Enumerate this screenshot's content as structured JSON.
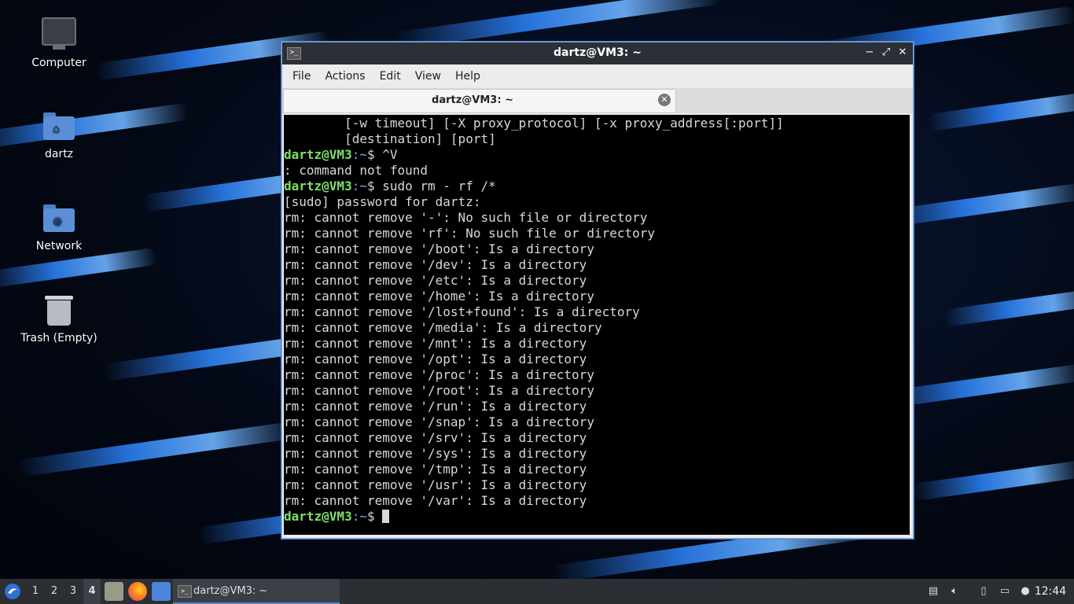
{
  "desktop": {
    "icons": [
      {
        "label": "Computer"
      },
      {
        "label": "dartz"
      },
      {
        "label": "Network"
      },
      {
        "label": "Trash (Empty)"
      }
    ]
  },
  "window": {
    "title": "dartz@VM3: ~",
    "controls": {
      "minimize": "−",
      "maximize": "⤢",
      "close": "✕"
    },
    "menu": [
      "File",
      "Actions",
      "Edit",
      "View",
      "Help"
    ],
    "tab": {
      "label": "dartz@VM3: ~",
      "close": "✕"
    }
  },
  "terminal": {
    "prompt_user": "dartz@VM3",
    "prompt_path": ":~",
    "prompt_symbol": "$ ",
    "lines": [
      {
        "type": "out",
        "text": "        [-w timeout] [-X proxy_protocol] [-x proxy_address[:port]]"
      },
      {
        "type": "out",
        "text": "        [destination] [port]"
      },
      {
        "type": "cmd",
        "text": "^V"
      },
      {
        "type": "out",
        "text": ": command not found"
      },
      {
        "type": "cmd",
        "text": "sudo rm - rf /*"
      },
      {
        "type": "out",
        "text": "[sudo] password for dartz:"
      },
      {
        "type": "out",
        "text": "rm: cannot remove '-': No such file or directory"
      },
      {
        "type": "out",
        "text": "rm: cannot remove 'rf': No such file or directory"
      },
      {
        "type": "out",
        "text": "rm: cannot remove '/boot': Is a directory"
      },
      {
        "type": "out",
        "text": "rm: cannot remove '/dev': Is a directory"
      },
      {
        "type": "out",
        "text": "rm: cannot remove '/etc': Is a directory"
      },
      {
        "type": "out",
        "text": "rm: cannot remove '/home': Is a directory"
      },
      {
        "type": "out",
        "text": "rm: cannot remove '/lost+found': Is a directory"
      },
      {
        "type": "out",
        "text": "rm: cannot remove '/media': Is a directory"
      },
      {
        "type": "out",
        "text": "rm: cannot remove '/mnt': Is a directory"
      },
      {
        "type": "out",
        "text": "rm: cannot remove '/opt': Is a directory"
      },
      {
        "type": "out",
        "text": "rm: cannot remove '/proc': Is a directory"
      },
      {
        "type": "out",
        "text": "rm: cannot remove '/root': Is a directory"
      },
      {
        "type": "out",
        "text": "rm: cannot remove '/run': Is a directory"
      },
      {
        "type": "out",
        "text": "rm: cannot remove '/snap': Is a directory"
      },
      {
        "type": "out",
        "text": "rm: cannot remove '/srv': Is a directory"
      },
      {
        "type": "out",
        "text": "rm: cannot remove '/sys': Is a directory"
      },
      {
        "type": "out",
        "text": "rm: cannot remove '/tmp': Is a directory"
      },
      {
        "type": "out",
        "text": "rm: cannot remove '/usr': Is a directory"
      },
      {
        "type": "out",
        "text": "rm: cannot remove '/var': Is a directory"
      },
      {
        "type": "cmd",
        "text": ""
      }
    ]
  },
  "taskbar": {
    "workspaces": [
      "1",
      "2",
      "3",
      "4"
    ],
    "active_workspace": "4",
    "task_label": "dartz@VM3: ~",
    "clock": "12:44"
  },
  "colors": {
    "prompt_user": "#7ee06c",
    "prompt_path": "#7aa6ff",
    "window_border": "#7ea6e0"
  }
}
